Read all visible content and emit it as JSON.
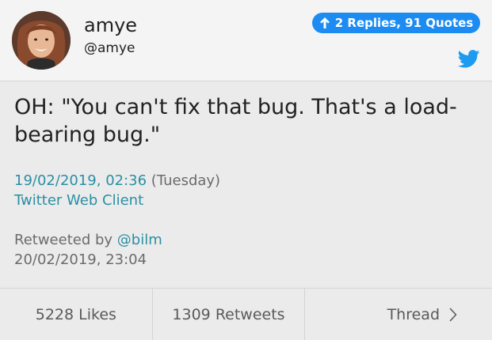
{
  "user": {
    "name": "amye",
    "handle": "@amye",
    "avatar_icon": "avatar-photo"
  },
  "replies": {
    "label": "2 Replies, 91 Quotes",
    "icon": "arrow-up-icon",
    "color": "#1d8cf2"
  },
  "brand_icon": "twitter-bird-icon",
  "tweet": {
    "line1": "OH: \"You can't fix that bug. That's a load-",
    "line2": "bearing bug.\""
  },
  "timestamp": {
    "date": "19/02/2019, 02:36",
    "weekday": "(Tuesday)",
    "client": "Twitter Web Client"
  },
  "retweet": {
    "prefix": "Retweeted by",
    "by": "@bilm",
    "date": "20/02/2019, 23:04"
  },
  "footer": {
    "likes": "5228 Likes",
    "retweets": "1309 Retweets",
    "thread": "Thread"
  },
  "colors": {
    "link": "#2a8fa4",
    "background": "#ebebeb",
    "header": "#f4f4f4"
  }
}
